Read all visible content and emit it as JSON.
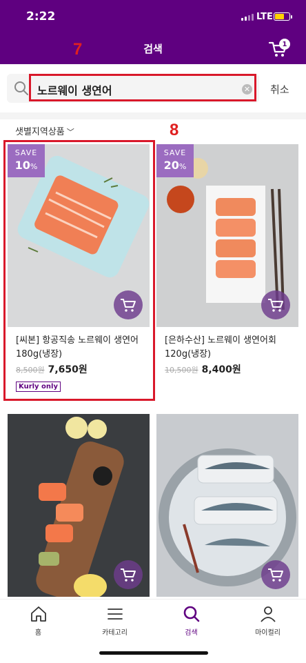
{
  "status": {
    "time": "2:22",
    "network": "LTE"
  },
  "header": {
    "title": "검색",
    "cart_count": "1"
  },
  "annotations": {
    "a7": "7",
    "a8": "8"
  },
  "search": {
    "query": "노르웨이 생연어",
    "cancel_label": "취소"
  },
  "filter": {
    "label": "샛별지역상품"
  },
  "products": [
    {
      "save_word": "SAVE",
      "discount_num": "10",
      "discount_pct": "%",
      "name": "[씨본] 항공직송 노르웨이 생연어 180g(냉장)",
      "orig_price": "8,500원",
      "sale_price": "7,650원",
      "badge": "Kurly only"
    },
    {
      "save_word": "SAVE",
      "discount_num": "20",
      "discount_pct": "%",
      "name": "[은하수산] 노르웨이 생연어회 120g(냉장)",
      "orig_price": "10,500원",
      "sale_price": "8,400원"
    }
  ],
  "nav": [
    {
      "label": "홈",
      "icon": "home-icon"
    },
    {
      "label": "카테고리",
      "icon": "menu-icon"
    },
    {
      "label": "검색",
      "icon": "search-icon",
      "active": true
    },
    {
      "label": "마이컬리",
      "icon": "user-icon"
    }
  ],
  "colors": {
    "brand": "#5f0080",
    "annotation": "#d9182a",
    "save_badge": "#9b6cc0"
  }
}
